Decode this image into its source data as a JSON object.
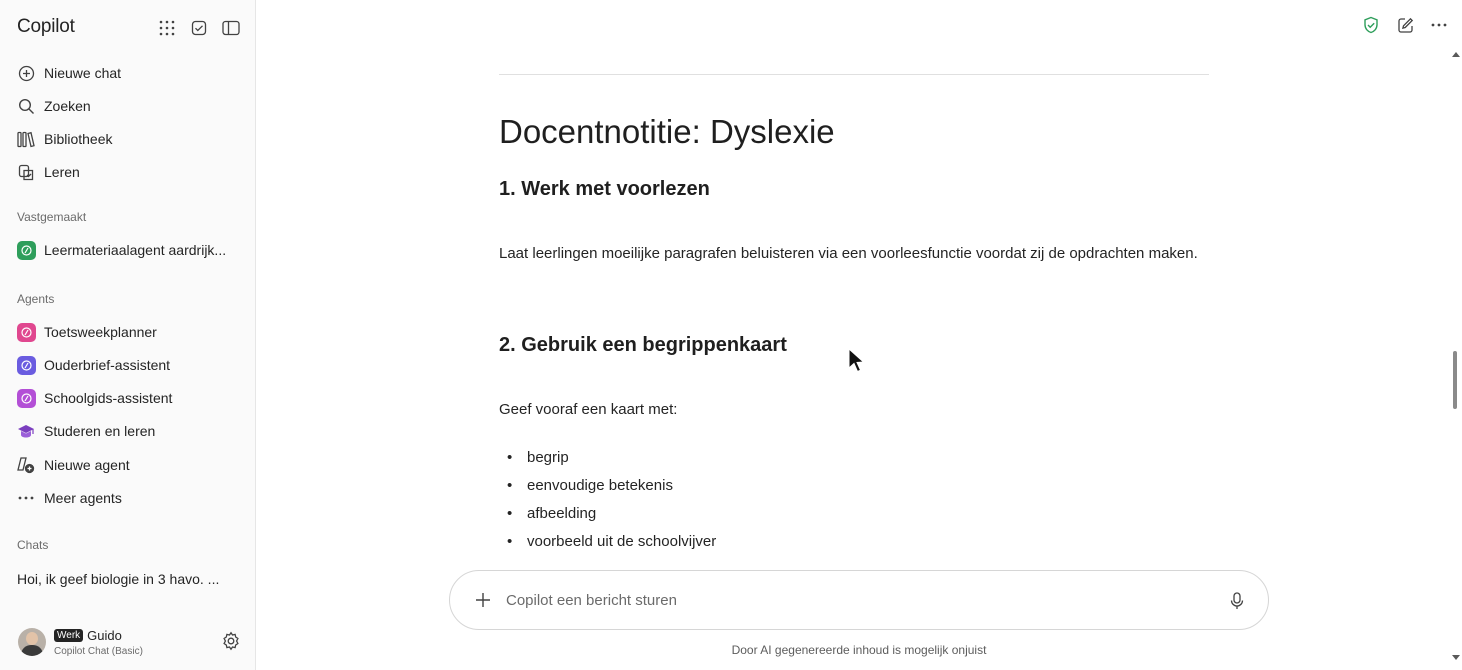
{
  "sidebar": {
    "brand": "Copilot",
    "nav": [
      {
        "label": "Nieuwe chat",
        "icon": "plus-circle-icon"
      },
      {
        "label": "Zoeken",
        "icon": "search-icon"
      },
      {
        "label": "Bibliotheek",
        "icon": "library-icon"
      },
      {
        "label": "Leren",
        "icon": "learn-icon"
      }
    ],
    "pinned_label": "Vastgemaakt",
    "pinned": [
      {
        "label": "Leermateriaalagent aardrijk...",
        "color": "#2e9e5b"
      }
    ],
    "agents_label": "Agents",
    "agents": [
      {
        "label": "Toetsweekplanner",
        "color": "#e0478f"
      },
      {
        "label": "Ouderbrief-assistent",
        "color": "#6a5ce0"
      },
      {
        "label": "Schoolgids-assistent",
        "color": "#b34fd6"
      },
      {
        "label": "Studeren en leren",
        "color": "#7b3fbf"
      },
      {
        "label": "Nieuwe agent"
      },
      {
        "label": "Meer agents"
      }
    ],
    "chats_label": "Chats",
    "chats": [
      "Hoi, ik geef biologie in 3 havo. ..."
    ],
    "user": {
      "tag": "Werk",
      "name": "Guido",
      "plan": "Copilot Chat (Basic)"
    }
  },
  "document": {
    "title": "Docentnotitie: Dyslexie",
    "section1_heading": "1. Werk met voorlezen",
    "section1_text": "Laat leerlingen moeilijke paragrafen beluisteren via een voorleesfunctie voordat zij de opdrachten maken.",
    "section2_heading": "2. Gebruik een begrippenkaart",
    "section2_text": "Geef vooraf een kaart met:",
    "bullets": [
      "begrip",
      "eenvoudige betekenis",
      "afbeelding",
      "voorbeeld uit de schoolvijver"
    ]
  },
  "composer": {
    "placeholder": "Copilot een bericht sturen"
  },
  "disclaimer": "Door AI gegenereerde inhoud is mogelijk onjuist",
  "colors": {
    "shield": "#2e9e5b",
    "text": "#242424"
  }
}
